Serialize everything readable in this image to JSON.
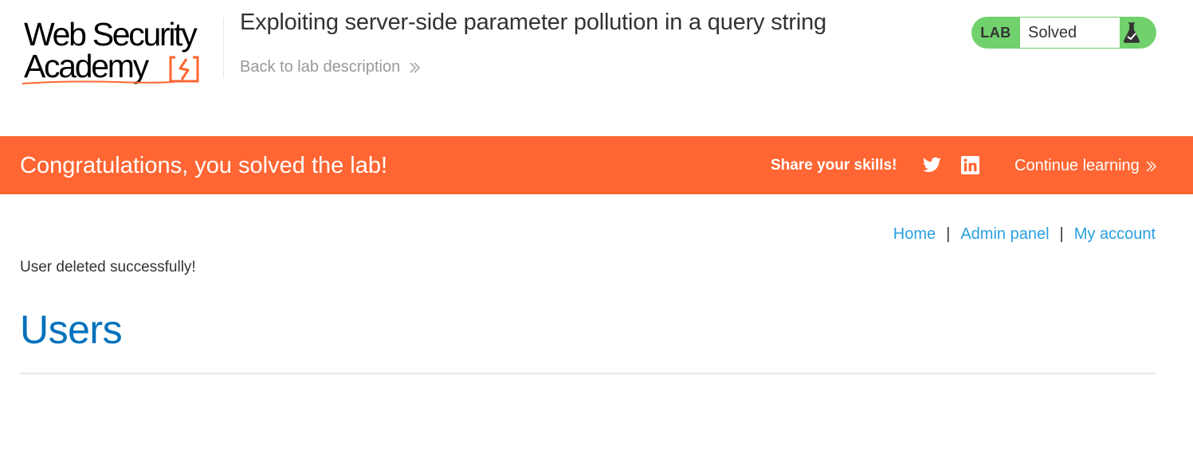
{
  "header": {
    "logo": {
      "line1": "Web Security",
      "line2": "Academy"
    },
    "lab_title": "Exploiting server-side parameter pollution in a query string",
    "back_link": "Back to lab description",
    "status": {
      "tag": "LAB",
      "value": "Solved"
    }
  },
  "banner": {
    "message": "Congratulations, you solved the lab!",
    "share_label": "Share your skills!",
    "continue_label": "Continue learning"
  },
  "nav": {
    "home": "Home",
    "admin_panel": "Admin panel",
    "my_account": "My account",
    "separator": "|"
  },
  "main": {
    "flash_message": "User deleted successfully!",
    "heading": "Users"
  },
  "colors": {
    "banner": "#ff6633",
    "status_green": "#70d16d",
    "link": "#29a0df",
    "heading": "#0071bc",
    "logo_accent": "#ff6633"
  },
  "icons": [
    "logo-mark-icon",
    "double-chevron-right-icon",
    "flask-icon",
    "twitter-icon",
    "linkedin-icon"
  ]
}
